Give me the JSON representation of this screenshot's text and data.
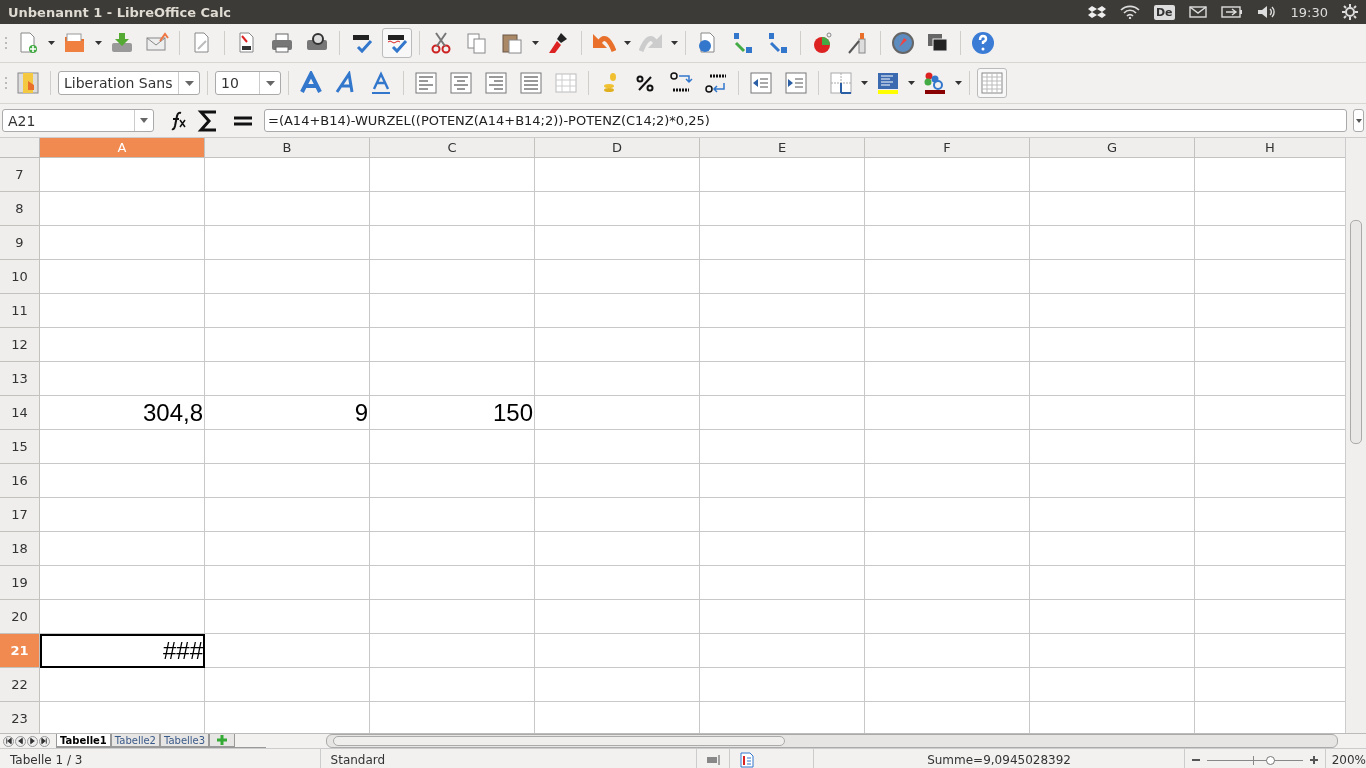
{
  "window": {
    "title": "Unbenannt 1 - LibreOffice Calc"
  },
  "tray": {
    "keyboard": "De",
    "time": "19:30"
  },
  "formatting": {
    "font_name": "Liberation Sans",
    "font_size": "10"
  },
  "formula_bar": {
    "name_box": "A21",
    "formula": "=(A14+B14)-WURZEL((POTENZ(A14+B14;2))-POTENZ(C14;2)*0,25)"
  },
  "columns": [
    {
      "label": "A",
      "selected": true
    },
    {
      "label": "B",
      "selected": false
    },
    {
      "label": "C",
      "selected": false
    },
    {
      "label": "D",
      "selected": false
    },
    {
      "label": "E",
      "selected": false
    },
    {
      "label": "F",
      "selected": false
    },
    {
      "label": "G",
      "selected": false
    },
    {
      "label": "H",
      "selected": false
    }
  ],
  "rows": [
    {
      "label": "7",
      "selected": false
    },
    {
      "label": "8",
      "selected": false
    },
    {
      "label": "9",
      "selected": false
    },
    {
      "label": "10",
      "selected": false
    },
    {
      "label": "11",
      "selected": false
    },
    {
      "label": "12",
      "selected": false
    },
    {
      "label": "13",
      "selected": false
    },
    {
      "label": "14",
      "selected": false,
      "cells": [
        "304,8",
        "9",
        "150"
      ]
    },
    {
      "label": "15",
      "selected": false
    },
    {
      "label": "16",
      "selected": false
    },
    {
      "label": "17",
      "selected": false
    },
    {
      "label": "18",
      "selected": false
    },
    {
      "label": "19",
      "selected": false
    },
    {
      "label": "20",
      "selected": false
    },
    {
      "label": "21",
      "selected": true,
      "cells": [
        "###"
      ]
    },
    {
      "label": "22",
      "selected": false
    },
    {
      "label": "23",
      "selected": false
    }
  ],
  "sheet_tabs": [
    {
      "label": "Tabelle1",
      "selected": true
    },
    {
      "label": "Tabelle2",
      "selected": false
    },
    {
      "label": "Tabelle3",
      "selected": false
    }
  ],
  "status_bar": {
    "sheet": "Tabelle 1 / 3",
    "page_style": "Standard",
    "sum": "Summe=9,0945028392",
    "zoom": "200%",
    "zoom_slider": {
      "level": 0.66
    }
  }
}
